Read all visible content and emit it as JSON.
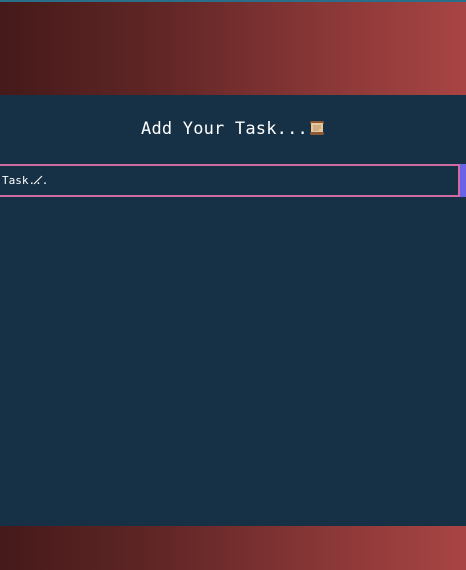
{
  "header": {
    "title": "Add Your Task...",
    "title_icon": "scroll-icon"
  },
  "task_input": {
    "placeholder": "Task...",
    "value": "",
    "trailing_icon": "pencil-icon"
  },
  "colors": {
    "background": "#163145",
    "band_gradient_start": "#451a1a",
    "band_gradient_end": "#a94444",
    "input_border": "#d06aa3",
    "button": "#6a63e8",
    "text": "#ffffff"
  }
}
